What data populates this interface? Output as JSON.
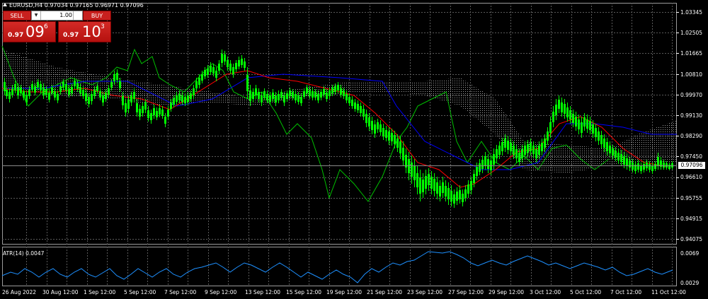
{
  "header": {
    "symbol_line": "EURUSD,H4  0.97034 0.97165 0.96971 0.97096"
  },
  "trade_panel": {
    "sell_label": "SELL",
    "buy_label": "BUY",
    "lot_value": "1.00",
    "sell_price": {
      "small": "0.97",
      "big": "09",
      "sup": "6"
    },
    "buy_price": {
      "small": "0.97",
      "big": "10",
      "sup": "3"
    }
  },
  "main_axis": {
    "labels": [
      "1.03345",
      "1.02505",
      "1.01665",
      "1.00810",
      "0.99970",
      "0.99130",
      "0.98290",
      "0.97450",
      "0.96610",
      "0.95755",
      "0.94915",
      "0.94075"
    ],
    "current_price": "0.97096"
  },
  "atr": {
    "label": "ATR(14) 0.0047",
    "axis_labels": [
      "0.0069",
      "0.0029"
    ]
  },
  "time_axis": {
    "labels": [
      "26 Aug 2022",
      "30 Aug 12:00",
      "1 Sep 12:00",
      "5 Sep 12:00",
      "7 Sep 12:00",
      "9 Sep 12:00",
      "13 Sep 12:00",
      "15 Sep 12:00",
      "19 Sep 12:00",
      "21 Sep 12:00",
      "23 Sep 12:00",
      "27 Sep 12:00",
      "29 Sep 12:00",
      "3 Oct 12:00",
      "5 Oct 12:00",
      "7 Oct 12:00",
      "11 Oct 12:00"
    ]
  },
  "colors": {
    "background": "#000000",
    "grid": "#5a5a5a",
    "candle": "#00ff00",
    "tenkan": "#ff0000",
    "kijun": "#0000ff",
    "chikou": "#00c000",
    "kumo_bear": "#ffffff",
    "kumo_bull": "#d2b48c",
    "atr_line": "#1e90ff",
    "sell_button": "#c8201e"
  }
}
